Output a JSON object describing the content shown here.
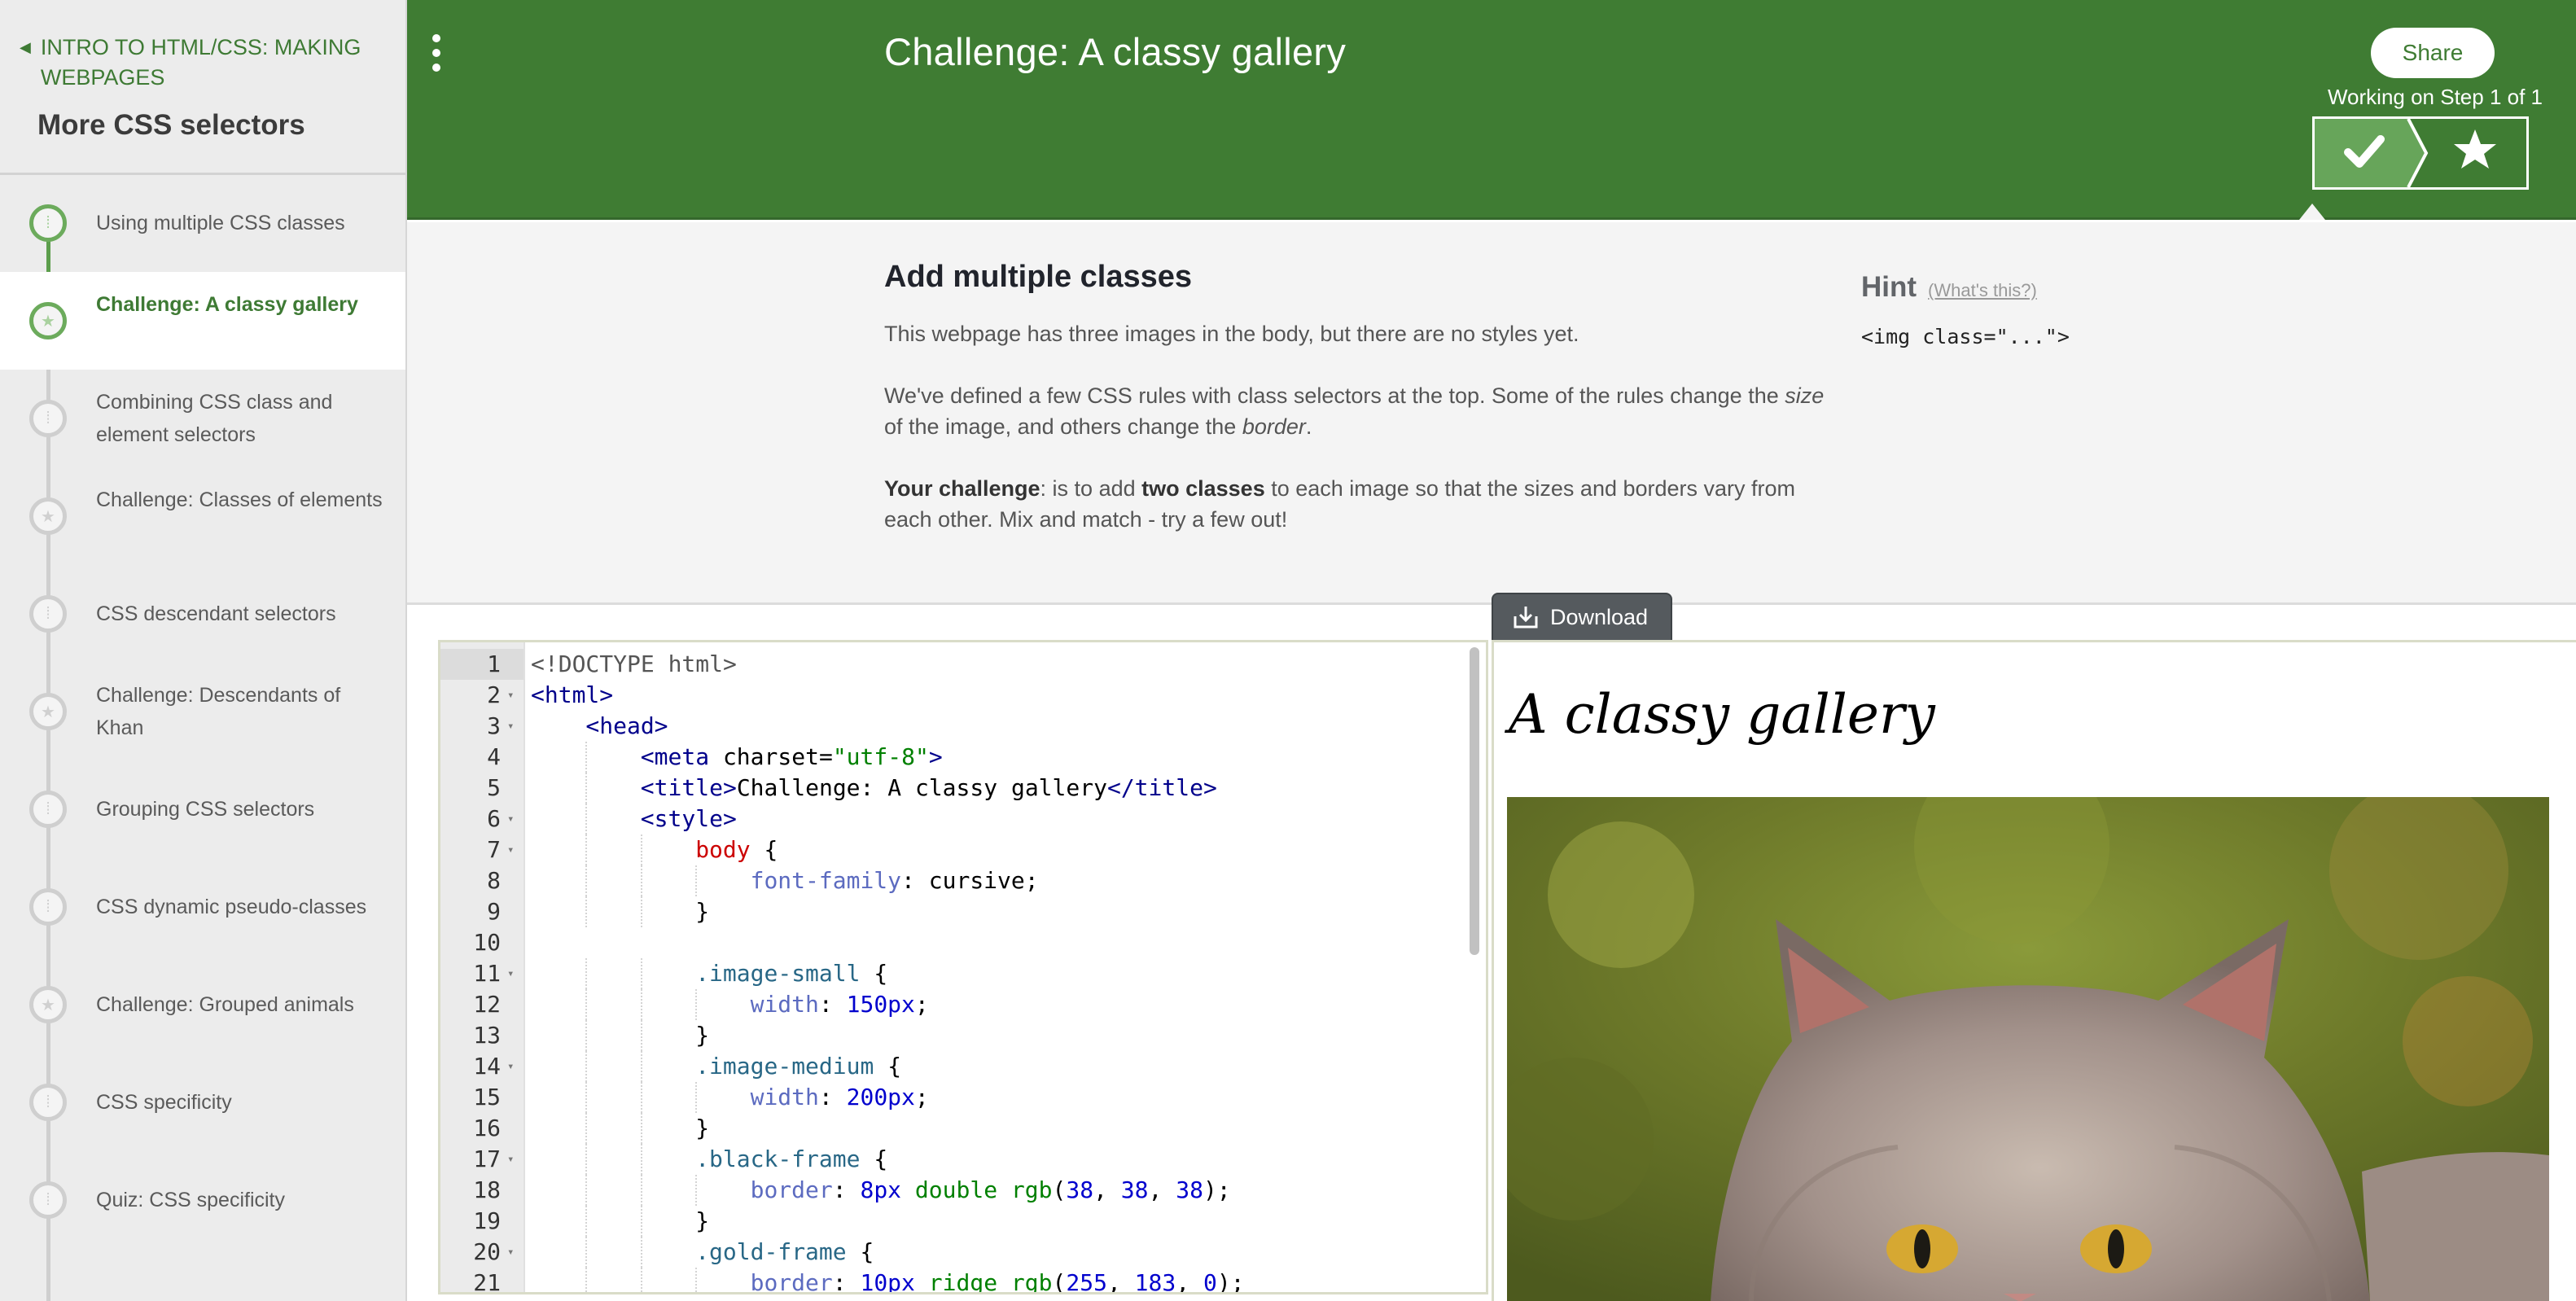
{
  "sidebar": {
    "breadcrumb": "INTRO TO HTML/CSS: MAKING WEBPAGES",
    "topic_title": "More CSS selectors",
    "items": [
      {
        "label": "Using multiple CSS classes",
        "type": "talkthrough",
        "state": "done"
      },
      {
        "label": "Challenge: A classy gallery",
        "type": "challenge",
        "state": "active"
      },
      {
        "label": "Combining CSS class and element selectors",
        "type": "talkthrough",
        "state": "todo"
      },
      {
        "label": "Challenge: Classes of elements",
        "type": "challenge",
        "state": "todo"
      },
      {
        "label": "CSS descendant selectors",
        "type": "talkthrough",
        "state": "todo"
      },
      {
        "label": "Challenge: Descendants of Khan",
        "type": "challenge",
        "state": "todo"
      },
      {
        "label": "Grouping CSS selectors",
        "type": "talkthrough",
        "state": "todo"
      },
      {
        "label": "CSS dynamic pseudo-classes",
        "type": "talkthrough",
        "state": "todo"
      },
      {
        "label": "Challenge: Grouped animals",
        "type": "challenge",
        "state": "todo"
      },
      {
        "label": "CSS specificity",
        "type": "talkthrough",
        "state": "todo"
      },
      {
        "label": "Quiz: CSS specificity",
        "type": "talkthrough",
        "state": "todo"
      }
    ]
  },
  "header": {
    "menu_icon": "vertical-dots-icon",
    "title": "Challenge: A classy gallery",
    "share_label": "Share",
    "progress_text": "Working on Step 1 of 1",
    "accent_color": "#3f7c33"
  },
  "instructions": {
    "heading": "Add multiple classes",
    "p1": "This webpage has three images in the body, but there are no styles yet.",
    "p2_a": "We've defined a few CSS rules with class selectors at the top. Some of the rules change the ",
    "p2_size": "size",
    "p2_b": " of the image, and others change the ",
    "p2_border": "border",
    "p2_c": ".",
    "p3_bold1": "Your challenge",
    "p3_a": ": is to add ",
    "p3_bold2": "two classes",
    "p3_b": " to each image so that the sizes and borders vary from each other. Mix and match - try a few out!"
  },
  "hint": {
    "title": "Hint",
    "whats_this": "(What's this?)",
    "code": "<img class=\"...\">"
  },
  "download_label": "Download",
  "editor": {
    "lines": [
      {
        "n": "1",
        "fold": false,
        "indent": 0,
        "tokens": [
          [
            "doc",
            "<!DOCTYPE html>"
          ]
        ]
      },
      {
        "n": "2",
        "fold": true,
        "indent": 0,
        "tokens": [
          [
            "tag",
            "<html>"
          ]
        ]
      },
      {
        "n": "3",
        "fold": true,
        "indent": 1,
        "tokens": [
          [
            "tag",
            "<head>"
          ]
        ]
      },
      {
        "n": "4",
        "fold": false,
        "indent": 2,
        "tokens": [
          [
            "tag",
            "<meta"
          ],
          [
            "attr",
            " charset="
          ],
          [
            "str",
            "\"utf-8\""
          ],
          [
            "tag",
            ">"
          ]
        ]
      },
      {
        "n": "5",
        "fold": false,
        "indent": 2,
        "tokens": [
          [
            "tag",
            "<title>"
          ],
          [
            "attr",
            "Challenge: A classy gallery"
          ],
          [
            "tag",
            "</title>"
          ]
        ]
      },
      {
        "n": "6",
        "fold": true,
        "indent": 2,
        "tokens": [
          [
            "tag",
            "<style>"
          ]
        ]
      },
      {
        "n": "7",
        "fold": true,
        "indent": 3,
        "tokens": [
          [
            "sel",
            "body"
          ],
          [
            "attr",
            " {"
          ]
        ]
      },
      {
        "n": "8",
        "fold": false,
        "indent": 4,
        "tokens": [
          [
            "prop",
            "font-family"
          ],
          [
            "attr",
            ": cursive;"
          ]
        ]
      },
      {
        "n": "9",
        "fold": false,
        "indent": 3,
        "tokens": [
          [
            "attr",
            "}"
          ]
        ]
      },
      {
        "n": "10",
        "fold": false,
        "indent": 0,
        "tokens": []
      },
      {
        "n": "11",
        "fold": true,
        "indent": 3,
        "tokens": [
          [
            "cls",
            ".image-small"
          ],
          [
            "attr",
            " {"
          ]
        ]
      },
      {
        "n": "12",
        "fold": false,
        "indent": 4,
        "tokens": [
          [
            "prop",
            "width"
          ],
          [
            "attr",
            ": "
          ],
          [
            "num",
            "150px"
          ],
          [
            "attr",
            ";"
          ]
        ]
      },
      {
        "n": "13",
        "fold": false,
        "indent": 3,
        "tokens": [
          [
            "attr",
            "}"
          ]
        ]
      },
      {
        "n": "14",
        "fold": true,
        "indent": 3,
        "tokens": [
          [
            "cls",
            ".image-medium"
          ],
          [
            "attr",
            " {"
          ]
        ]
      },
      {
        "n": "15",
        "fold": false,
        "indent": 4,
        "tokens": [
          [
            "prop",
            "width"
          ],
          [
            "attr",
            ": "
          ],
          [
            "num",
            "200px"
          ],
          [
            "attr",
            ";"
          ]
        ]
      },
      {
        "n": "16",
        "fold": false,
        "indent": 3,
        "tokens": [
          [
            "attr",
            "}"
          ]
        ]
      },
      {
        "n": "17",
        "fold": true,
        "indent": 3,
        "tokens": [
          [
            "cls",
            ".black-frame"
          ],
          [
            "attr",
            " {"
          ]
        ]
      },
      {
        "n": "18",
        "fold": false,
        "indent": 4,
        "tokens": [
          [
            "prop",
            "border"
          ],
          [
            "attr",
            ": "
          ],
          [
            "num",
            "8px"
          ],
          [
            "attr",
            " "
          ],
          [
            "kw",
            "double"
          ],
          [
            "attr",
            " "
          ],
          [
            "kw",
            "rgb"
          ],
          [
            "attr",
            "("
          ],
          [
            "num",
            "38"
          ],
          [
            "attr",
            ", "
          ],
          [
            "num",
            "38"
          ],
          [
            "attr",
            ", "
          ],
          [
            "num",
            "38"
          ],
          [
            "attr",
            ");"
          ]
        ]
      },
      {
        "n": "19",
        "fold": false,
        "indent": 3,
        "tokens": [
          [
            "attr",
            "}"
          ]
        ]
      },
      {
        "n": "20",
        "fold": true,
        "indent": 3,
        "tokens": [
          [
            "cls",
            ".gold-frame"
          ],
          [
            "attr",
            " {"
          ]
        ]
      },
      {
        "n": "21",
        "fold": false,
        "indent": 4,
        "tokens": [
          [
            "prop",
            "border"
          ],
          [
            "attr",
            ": "
          ],
          [
            "num",
            "10px"
          ],
          [
            "attr",
            " "
          ],
          [
            "kw",
            "ridge"
          ],
          [
            "attr",
            " "
          ],
          [
            "kw",
            "rgb"
          ],
          [
            "attr",
            "("
          ],
          [
            "num",
            "255"
          ],
          [
            "attr",
            ", "
          ],
          [
            "num",
            "183"
          ],
          [
            "attr",
            ", "
          ],
          [
            "num",
            "0"
          ],
          [
            "attr",
            ");"
          ]
        ]
      }
    ]
  },
  "preview": {
    "title": "A classy gallery",
    "image_subject": "cat-photo"
  }
}
